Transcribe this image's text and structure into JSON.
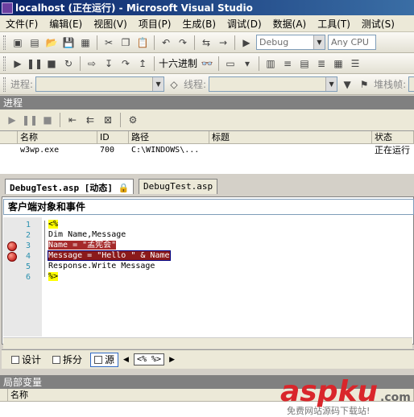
{
  "title": "localhost (正在运行) - Microsoft Visual Studio",
  "menu": [
    "文件(F)",
    "编辑(E)",
    "视图(V)",
    "项目(P)",
    "生成(B)",
    "调试(D)",
    "数据(A)",
    "工具(T)",
    "测试(S)"
  ],
  "toolbar1": {
    "config_value": "Debug",
    "platform_value": "Any CPU"
  },
  "toolbar2": {
    "hex_label": "十六进制"
  },
  "toolbar3": {
    "process_label": "进程:",
    "thread_label": "线程:",
    "stack_label": "堆栈帧:"
  },
  "process_panel": {
    "title": "进程",
    "columns": [
      "名称",
      "ID",
      "路径",
      "标题",
      "状态"
    ],
    "rows": [
      {
        "name": "w3wp.exe",
        "id": "700",
        "path": "C:\\WINDOWS\\...",
        "title": "",
        "status": "正在运行"
      }
    ]
  },
  "doc_tabs": [
    {
      "label": "DebugTest.asp [动态]",
      "active": true
    },
    {
      "label": "DebugTest.asp",
      "active": false
    }
  ],
  "scope": "客户端对象和事件",
  "code_lines": [
    {
      "num": "1",
      "text": "<%",
      "breakpoint": false
    },
    {
      "num": "2",
      "text": "Dim Name,Message",
      "breakpoint": false
    },
    {
      "num": "3",
      "text": "Name = \"孟宪会\"",
      "breakpoint": true
    },
    {
      "num": "4",
      "text": "Message = \"Hello \" & Name",
      "breakpoint": true
    },
    {
      "num": "5",
      "text": "Response.Write Message",
      "breakpoint": false
    },
    {
      "num": "6",
      "text": "%>",
      "breakpoint": false
    }
  ],
  "view_bar": {
    "design": "设计",
    "split": "拆分",
    "source": "源",
    "tag": "<%  %>"
  },
  "locals_panel": {
    "title": "局部变量",
    "name_col": "名称"
  },
  "watermark": {
    "logo": "aspku",
    "tld": ".com",
    "tagline": "免费网站源码下载站!"
  },
  "colors": {
    "titlebar": "#0a246a",
    "breakpoint": "#b20000",
    "highlight": "#a52a2a",
    "watermark_red": "#d9262b"
  }
}
